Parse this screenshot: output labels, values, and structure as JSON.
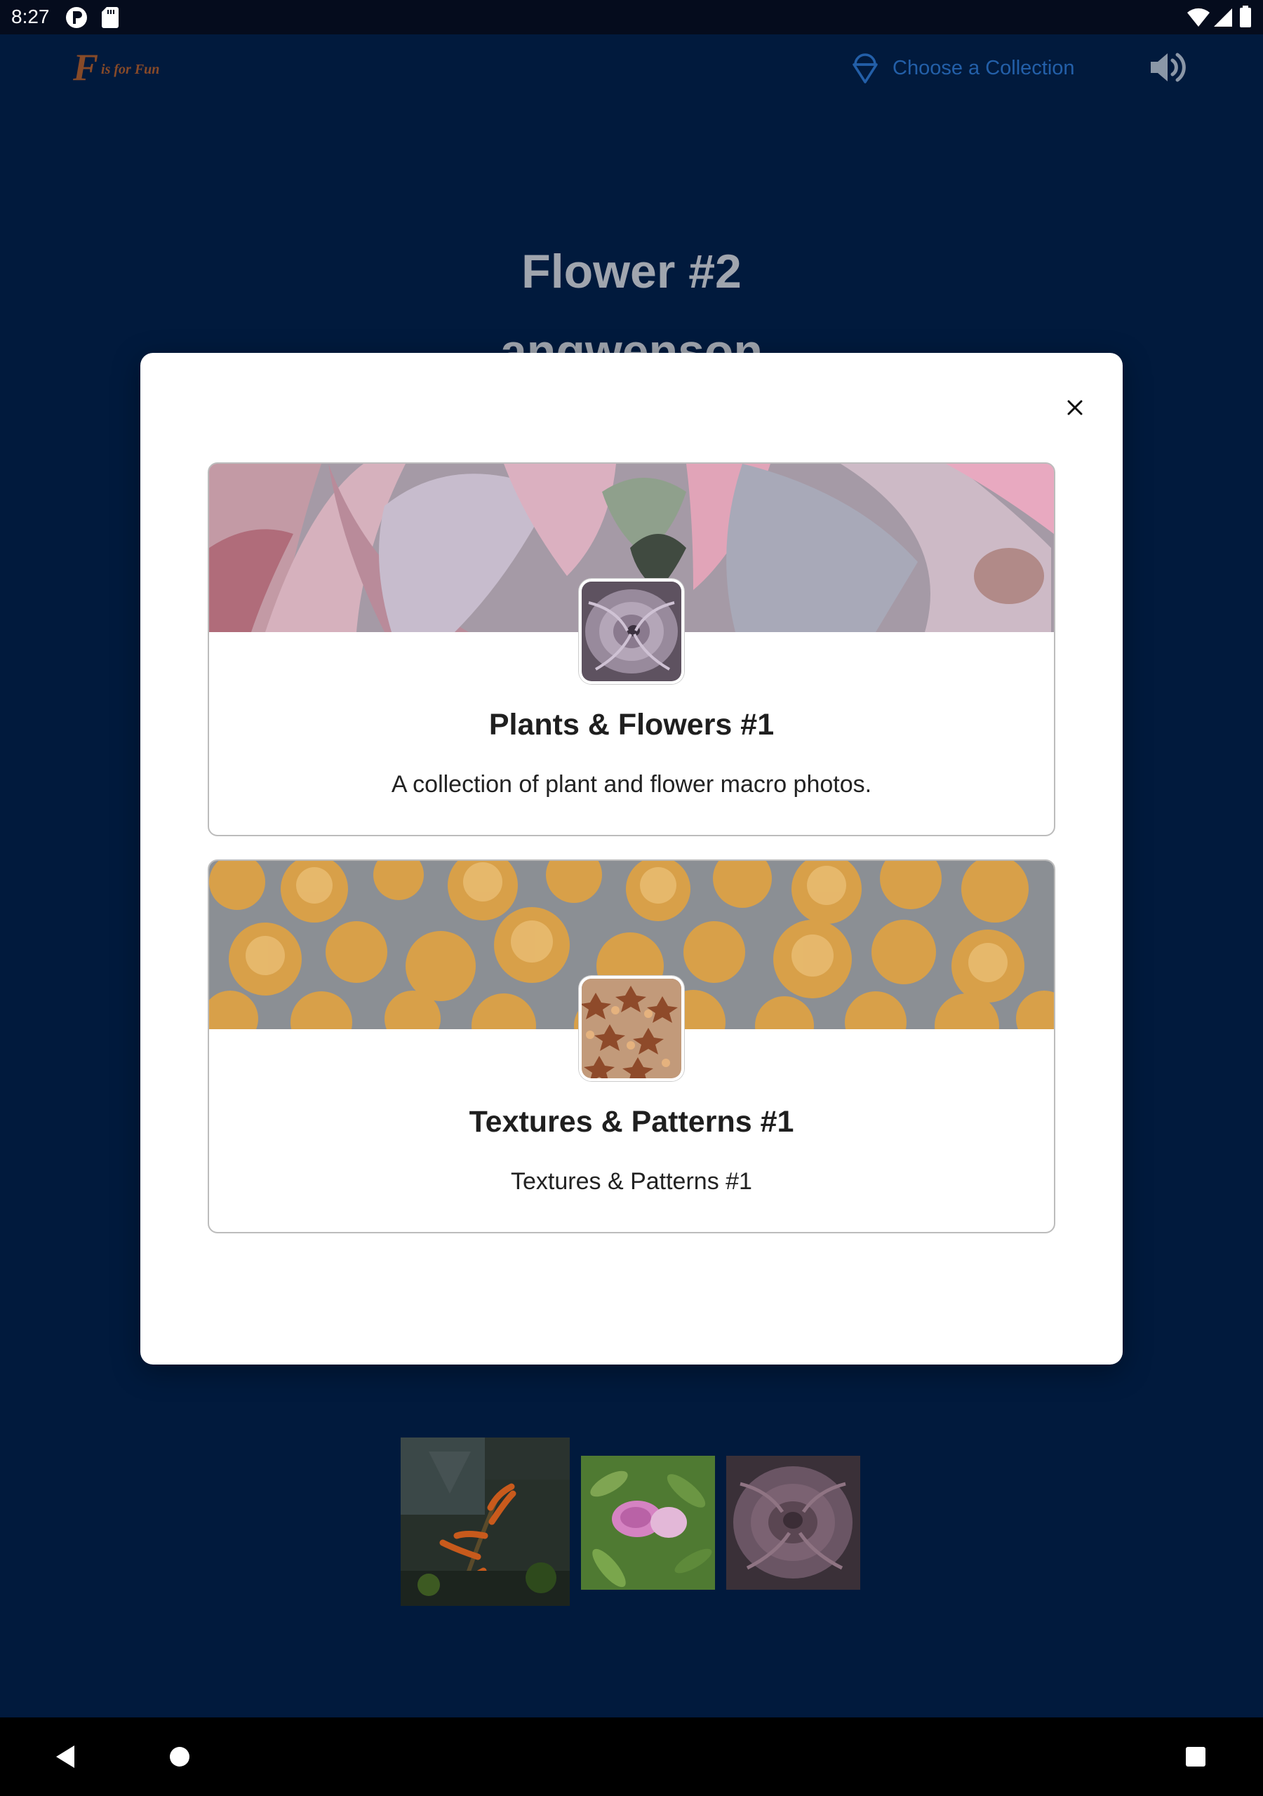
{
  "status_bar": {
    "time": "8:27"
  },
  "header": {
    "logo_letter": "F",
    "logo_text": "is for Fun",
    "choose_collection_label": "Choose a Collection"
  },
  "page": {
    "title": "Flower #2",
    "subtitle": "angwenson"
  },
  "modal": {
    "collections": [
      {
        "title": "Plants & Flowers #1",
        "description": "A collection of plant and flower macro photos."
      },
      {
        "title": "Textures & Patterns #1",
        "description": "Textures & Patterns #1"
      }
    ]
  },
  "colors": {
    "app_background": "#011a3d",
    "status_bar": "#050c1d",
    "accent_blue": "#3a8ef0",
    "logo_orange": "#e06a1b",
    "modal_background": "#ffffff"
  },
  "icons": {
    "status_left": [
      "p-app-icon",
      "sd-card-icon"
    ],
    "status_right": [
      "wifi-icon",
      "cell-signal-icon",
      "battery-icon"
    ],
    "header": [
      "ice-cream-icon",
      "volume-icon"
    ],
    "modal": [
      "close-icon"
    ],
    "nav": [
      "back-icon",
      "home-icon",
      "recents-icon"
    ]
  }
}
